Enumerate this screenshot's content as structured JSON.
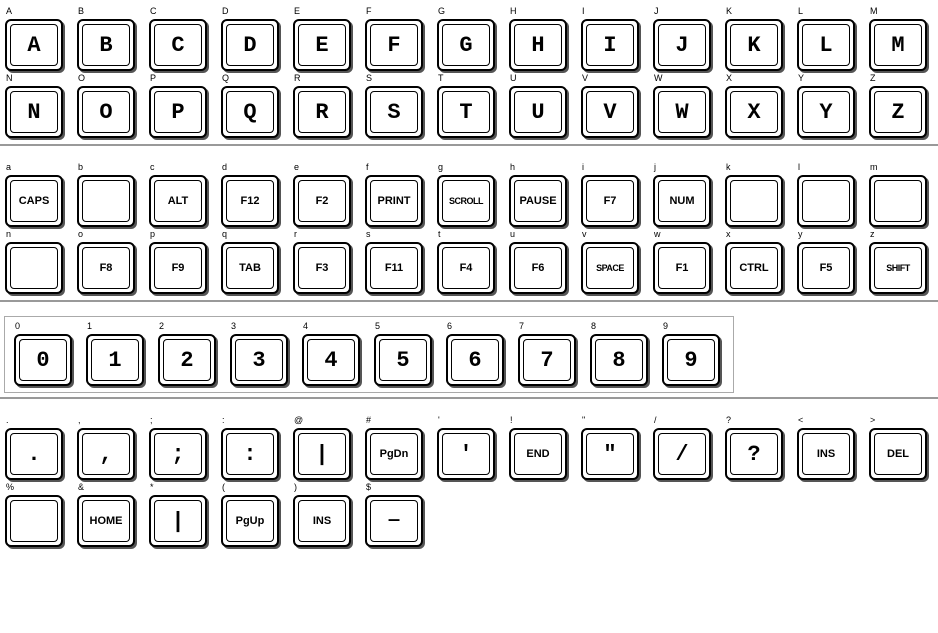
{
  "sections": [
    {
      "id": "uppercase",
      "rows": [
        {
          "cells": [
            {
              "label": "A",
              "display": "A"
            },
            {
              "label": "B",
              "display": "B"
            },
            {
              "label": "C",
              "display": "C"
            },
            {
              "label": "D",
              "display": "D"
            },
            {
              "label": "E",
              "display": "E"
            },
            {
              "label": "F",
              "display": "F"
            },
            {
              "label": "G",
              "display": "G"
            },
            {
              "label": "H",
              "display": "H"
            },
            {
              "label": "I",
              "display": "I"
            },
            {
              "label": "J",
              "display": "J"
            },
            {
              "label": "K",
              "display": "K"
            },
            {
              "label": "L",
              "display": "L"
            },
            {
              "label": "M",
              "display": "M"
            }
          ]
        },
        {
          "cells": [
            {
              "label": "N",
              "display": "N"
            },
            {
              "label": "O",
              "display": "O"
            },
            {
              "label": "P",
              "display": "P"
            },
            {
              "label": "Q",
              "display": "Q"
            },
            {
              "label": "R",
              "display": "R"
            },
            {
              "label": "S",
              "display": "S"
            },
            {
              "label": "T",
              "display": "T"
            },
            {
              "label": "U",
              "display": "U"
            },
            {
              "label": "V",
              "display": "V"
            },
            {
              "label": "W",
              "display": "W"
            },
            {
              "label": "X",
              "display": "X"
            },
            {
              "label": "Y",
              "display": "Y"
            },
            {
              "label": "Z",
              "display": "Z"
            }
          ]
        }
      ]
    },
    {
      "id": "lowercase-special",
      "rows": [
        {
          "cells": [
            {
              "label": "a",
              "display": "CAPS",
              "small": true
            },
            {
              "label": "b",
              "display": ""
            },
            {
              "label": "c",
              "display": "ALT",
              "small": true
            },
            {
              "label": "d",
              "display": "F12",
              "small": true
            },
            {
              "label": "e",
              "display": "F2",
              "small": true
            },
            {
              "label": "f",
              "display": "PRINT",
              "small": true
            },
            {
              "label": "g",
              "display": "SCROLL",
              "xsmall": true
            },
            {
              "label": "h",
              "display": "PAUSE",
              "small": true
            },
            {
              "label": "i",
              "display": "F7",
              "small": true
            },
            {
              "label": "j",
              "display": "NUM",
              "small": true
            },
            {
              "label": "k",
              "display": ""
            },
            {
              "label": "l",
              "display": ""
            },
            {
              "label": "m",
              "display": ""
            }
          ]
        },
        {
          "cells": [
            {
              "label": "n",
              "display": ""
            },
            {
              "label": "o",
              "display": "F8",
              "small": true
            },
            {
              "label": "p",
              "display": "F9",
              "small": true
            },
            {
              "label": "q",
              "display": "TAB",
              "small": true
            },
            {
              "label": "r",
              "display": "F3",
              "small": true
            },
            {
              "label": "s",
              "display": "F11",
              "small": true
            },
            {
              "label": "t",
              "display": "F4",
              "small": true
            },
            {
              "label": "u",
              "display": "F6",
              "small": true
            },
            {
              "label": "v",
              "display": "SPACE",
              "xsmall": true
            },
            {
              "label": "w",
              "display": "F1",
              "small": true
            },
            {
              "label": "x",
              "display": "CTRL",
              "small": true
            },
            {
              "label": "y",
              "display": "F5",
              "small": true
            },
            {
              "label": "z",
              "display": "SHIFT",
              "xsmall": true
            }
          ]
        }
      ]
    },
    {
      "id": "numbers",
      "rows": [
        {
          "cells": [
            {
              "label": "0",
              "display": "0"
            },
            {
              "label": "1",
              "display": "1"
            },
            {
              "label": "2",
              "display": "2"
            },
            {
              "label": "3",
              "display": "3"
            },
            {
              "label": "4",
              "display": "4"
            },
            {
              "label": "5",
              "display": "5"
            },
            {
              "label": "6",
              "display": "6"
            },
            {
              "label": "7",
              "display": "7"
            },
            {
              "label": "8",
              "display": "8"
            },
            {
              "label": "9",
              "display": "9"
            }
          ]
        }
      ]
    },
    {
      "id": "symbols",
      "rows": [
        {
          "cells": [
            {
              "label": ".",
              "display": "."
            },
            {
              "label": ",",
              "display": ","
            },
            {
              "label": ";",
              "display": ";"
            },
            {
              "label": ":",
              "display": ":"
            },
            {
              "label": "@",
              "display": "|"
            },
            {
              "label": "#",
              "display": "PgDn",
              "small": true
            },
            {
              "label": "'",
              "display": "'"
            },
            {
              "label": "!",
              "display": "END",
              "small": true
            },
            {
              "label": "\"",
              "display": "\""
            },
            {
              "label": "/",
              "display": "/"
            },
            {
              "label": "?",
              "display": "?"
            },
            {
              "label": "<",
              "display": "INS",
              "small": true
            },
            {
              "label": ">",
              "display": "DEL",
              "small": true
            }
          ]
        },
        {
          "cells": [
            {
              "label": "%",
              "display": ""
            },
            {
              "label": "&",
              "display": "HOME",
              "small": true
            },
            {
              "label": "*",
              "display": "|"
            },
            {
              "label": "(",
              "display": "PgUp",
              "small": true
            },
            {
              "label": ")",
              "display": "INS",
              "small": true
            },
            {
              "label": "$",
              "display": "—",
              "medium": true
            }
          ]
        }
      ]
    }
  ]
}
